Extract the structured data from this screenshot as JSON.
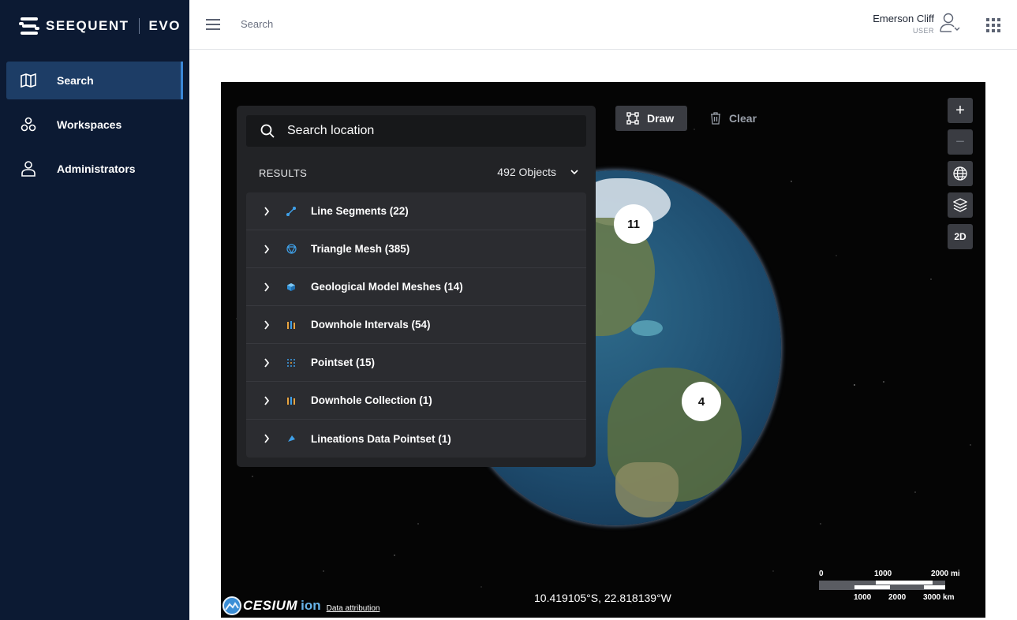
{
  "brand": {
    "name": "SEEQUENT",
    "product": "EVO"
  },
  "sidebar": {
    "items": [
      {
        "label": "Search",
        "icon": "map-icon",
        "active": true
      },
      {
        "label": "Workspaces",
        "icon": "workspaces-icon",
        "active": false
      },
      {
        "label": "Administrators",
        "icon": "person-icon",
        "active": false
      }
    ]
  },
  "topbar": {
    "title": "Search",
    "user_name": "Emerson Cliff",
    "user_role": "USER"
  },
  "map": {
    "draw_label": "Draw",
    "clear_label": "Clear",
    "controls": {
      "zoom_in": "+",
      "zoom_out": "−",
      "view_2d": "2D"
    },
    "clusters": [
      "11",
      "4"
    ],
    "coordinates": "10.419105°S, 22.818139°W",
    "attribution": {
      "cesium": "CESIUM",
      "ion": "ion",
      "link": "Data attribution"
    },
    "scale": {
      "mi_labels": [
        "0",
        "1000",
        "2000 mi"
      ],
      "km_labels": [
        "1000",
        "2000",
        "3000 km"
      ]
    }
  },
  "panel": {
    "search_placeholder": "Search location",
    "results_label": "RESULTS",
    "results_count": "492 Objects",
    "items": [
      {
        "label": "Line Segments (22)",
        "icon": "line-segments-icon",
        "color": "#3fa0e8"
      },
      {
        "label": "Triangle Mesh (385)",
        "icon": "triangle-mesh-icon",
        "color": "#3fa0e8"
      },
      {
        "label": "Geological Model Meshes (14)",
        "icon": "cube-icon",
        "color": "#3fa0e8"
      },
      {
        "label": "Downhole Intervals (54)",
        "icon": "downhole-icon",
        "color": "#e8a43f"
      },
      {
        "label": "Pointset (15)",
        "icon": "pointset-icon",
        "color": "#3fa0e8"
      },
      {
        "label": "Downhole Collection (1)",
        "icon": "downhole-icon",
        "color": "#e8a43f"
      },
      {
        "label": "Lineations Data Pointset (1)",
        "icon": "lineations-icon",
        "color": "#3fa0e8"
      }
    ]
  }
}
